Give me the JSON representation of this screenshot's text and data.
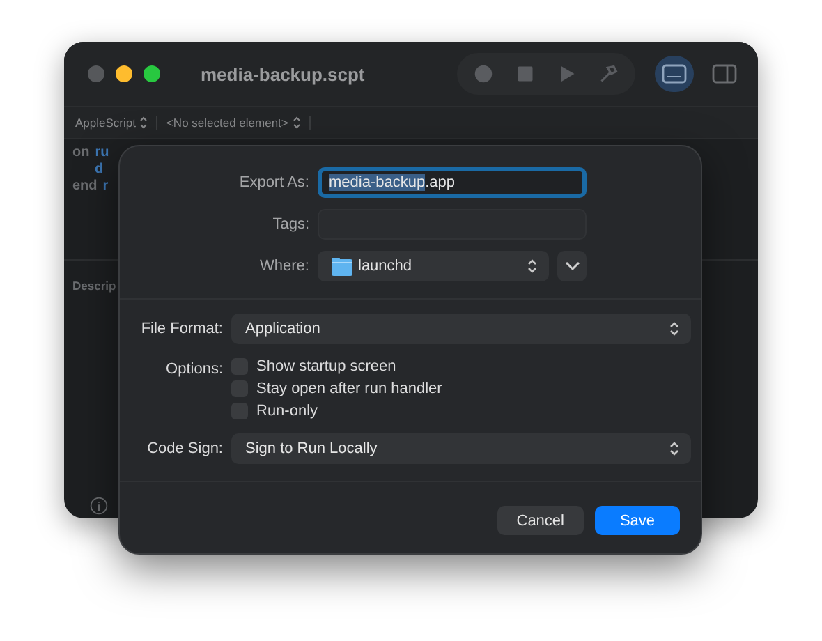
{
  "window": {
    "title": "media-backup.scpt"
  },
  "navigator": {
    "language": "AppleScript",
    "element": "<No selected element>"
  },
  "code_lines": [
    {
      "keyword": "on",
      "rest": "ru"
    },
    {
      "rest": "d"
    },
    {
      "keyword": "end",
      "rest": "r"
    }
  ],
  "description_label": "Descrip",
  "sheet": {
    "export_as": {
      "label": "Export As:",
      "selected_text": "media-backup",
      "unselected_text": ".app"
    },
    "tags": {
      "label": "Tags:"
    },
    "where": {
      "label": "Where:",
      "value": "launchd"
    },
    "file_format": {
      "label": "File Format:",
      "value": "Application"
    },
    "options": {
      "label": "Options:",
      "items": [
        {
          "label": "Show startup screen",
          "checked": false
        },
        {
          "label": "Stay open after run handler",
          "checked": false
        },
        {
          "label": "Run-only",
          "checked": false
        }
      ]
    },
    "code_sign": {
      "label": "Code Sign:",
      "value": "Sign to Run Locally"
    },
    "buttons": [
      {
        "label": "Cancel",
        "kind": "secondary"
      },
      {
        "label": "Save",
        "kind": "primary"
      }
    ]
  }
}
